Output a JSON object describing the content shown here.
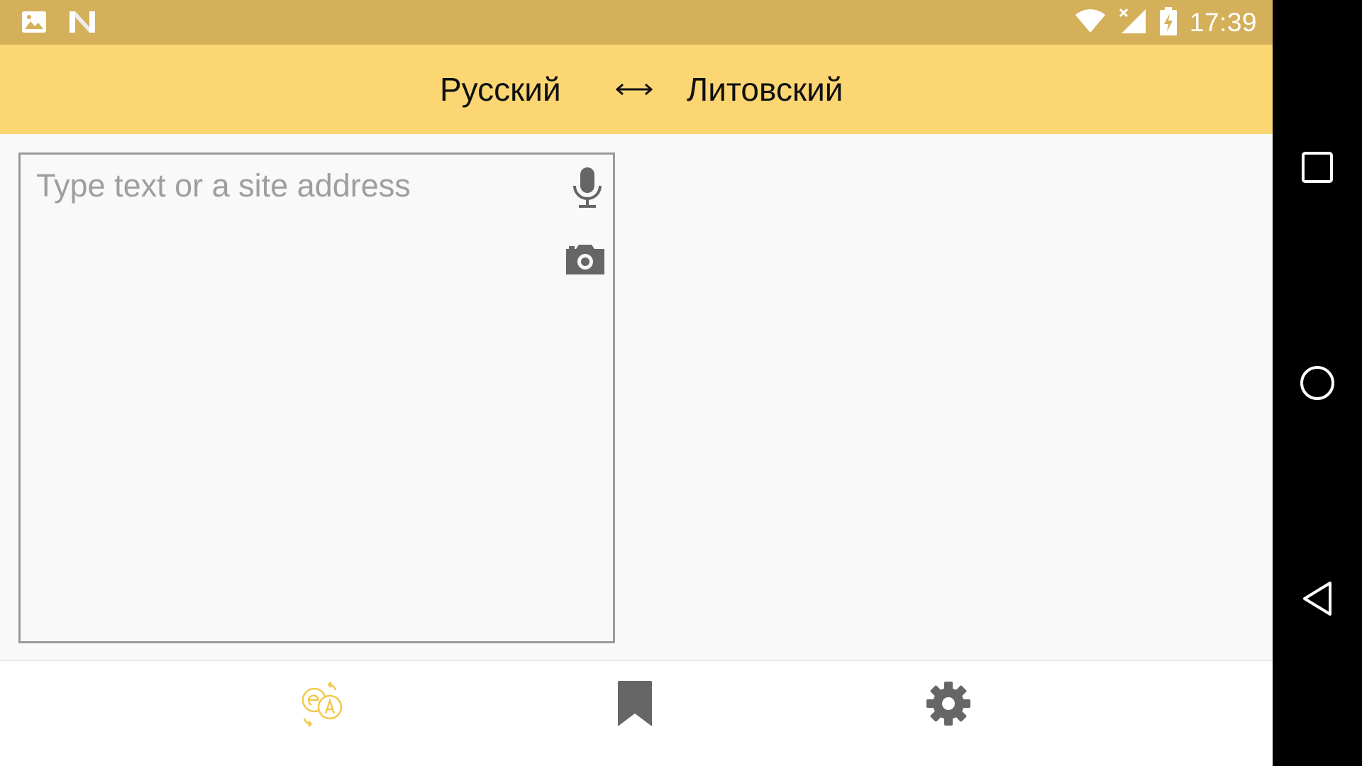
{
  "status_bar": {
    "time": "17:39",
    "left_icons": [
      "image-notification-icon",
      "n-logo-icon"
    ],
    "right_icons": [
      "wifi-icon",
      "cellular-no-signal-icon",
      "battery-charging-icon"
    ],
    "background": "#d4b05a"
  },
  "language_bar": {
    "source_language": "Русский",
    "swap_label": "⟷",
    "target_language": "Литовский",
    "background": "#fdd674"
  },
  "input": {
    "placeholder": "Type text or a site address",
    "value": "",
    "icons": [
      "microphone-icon",
      "camera-icon"
    ]
  },
  "bottom_nav": {
    "items": [
      {
        "name": "translate",
        "icon": "translate-icon",
        "active": true,
        "color": "#f2c94c"
      },
      {
        "name": "bookmarks",
        "icon": "bookmark-icon",
        "active": false,
        "color": "#666666"
      },
      {
        "name": "settings",
        "icon": "gear-icon",
        "active": false,
        "color": "#666666"
      }
    ]
  },
  "system_nav": {
    "buttons": [
      "recent-apps-icon",
      "home-icon",
      "back-icon"
    ]
  }
}
